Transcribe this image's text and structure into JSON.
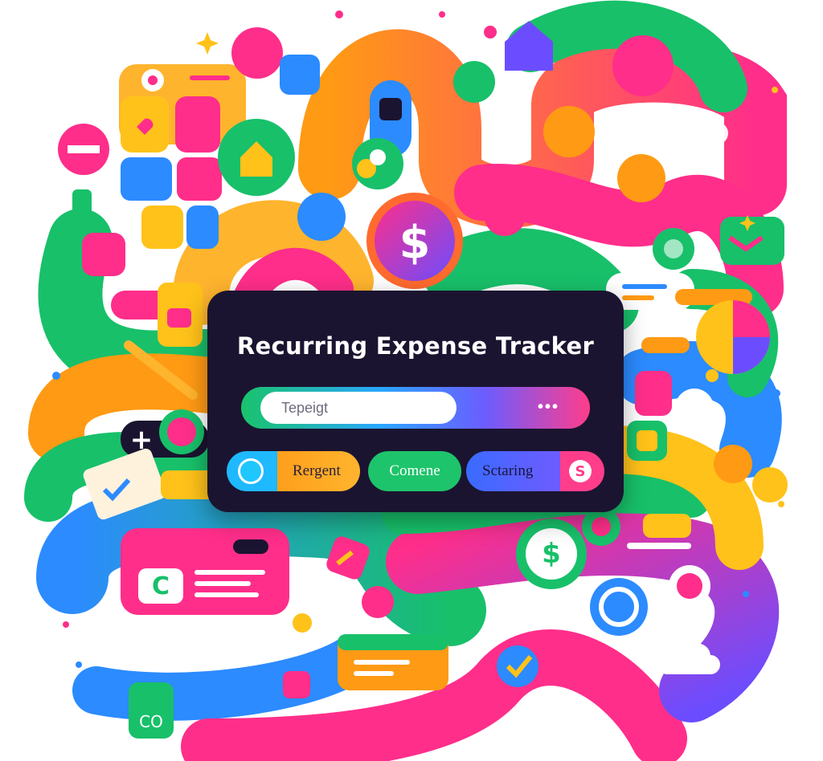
{
  "app": {
    "title": "Recurring Expense Tracker"
  },
  "search": {
    "placeholder": "Tepeigt",
    "more_label": "•••"
  },
  "tabs": [
    {
      "label": "Rergent"
    },
    {
      "label": "Comene"
    },
    {
      "label": "Sctaring"
    }
  ],
  "icons": {
    "dollar": "$",
    "plus": "+",
    "add_box": "C",
    "keypad": "CO",
    "sort_icon": "S"
  },
  "colors": {
    "panel": "#1b1430",
    "pink": "#ff2e8a",
    "green": "#18c06a",
    "blue": "#2c8bff",
    "orange": "#ff9a14",
    "purple": "#6b4dff",
    "yellow": "#ffc21a"
  }
}
